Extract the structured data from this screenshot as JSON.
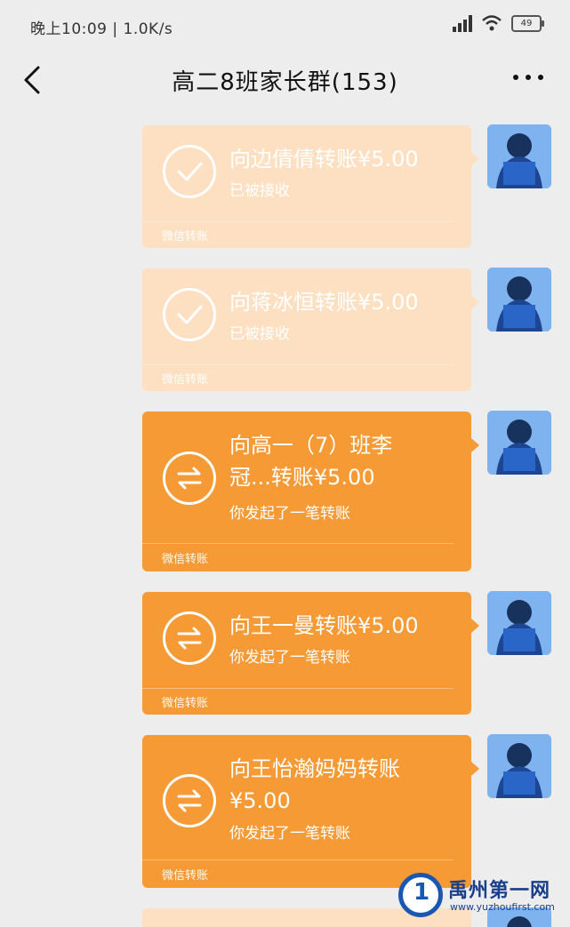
{
  "status_bar": {
    "time_speed": "晚上10:09 | 1.0K/s",
    "battery": "49"
  },
  "header": {
    "title": "高二8班家长群(153)"
  },
  "messages": [
    {
      "status": "received",
      "title": "向边倩倩转账¥5.00",
      "subtitle": "已被接收",
      "footer": "微信转账"
    },
    {
      "status": "received",
      "title": "向蒋冰恒转账¥5.00",
      "subtitle": "已被接收",
      "footer": "微信转账"
    },
    {
      "status": "pending",
      "title": "向高一（7）班李冠...转账¥5.00",
      "subtitle": "你发起了一笔转账",
      "footer": "微信转账"
    },
    {
      "status": "pending",
      "title": "向王一曼转账¥5.00",
      "subtitle": "你发起了一笔转账",
      "footer": "微信转账"
    },
    {
      "status": "pending",
      "title": "向王怡瀚妈妈转账 ¥5.00",
      "subtitle": "你发起了一笔转账",
      "footer": "微信转账"
    }
  ],
  "watermark": {
    "name": "禹州第一网",
    "url": "www.yuzhoufirst.com",
    "logo_char": "1"
  },
  "colors": {
    "received_bubble": "#fde0c2",
    "pending_bubble": "#f59a34",
    "avatar_bg": "#7fb3f0"
  },
  "icons": {
    "received": "check-circle-icon",
    "pending": "transfer-arrows-icon"
  }
}
